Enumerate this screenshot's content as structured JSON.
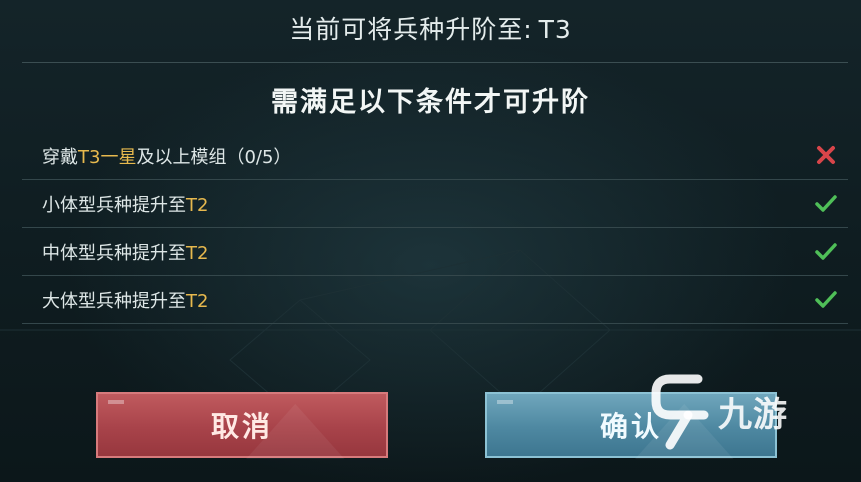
{
  "header": {
    "title": "当前可将兵种升阶至:",
    "tier": "T3"
  },
  "subtitle": "需满足以下条件才可升阶",
  "conditions": [
    {
      "prefix": "穿戴",
      "highlight": "T3一星",
      "suffix": "及以上模组（0/5）",
      "status": "failed",
      "status_icon": "cross-icon",
      "status_color": "#d8454a"
    },
    {
      "prefix": "小体型兵种提升至",
      "highlight": "T2",
      "suffix": "",
      "status": "met",
      "status_icon": "check-icon",
      "status_color": "#4fbf58"
    },
    {
      "prefix": "中体型兵种提升至",
      "highlight": "T2",
      "suffix": "",
      "status": "met",
      "status_icon": "check-icon",
      "status_color": "#4fbf58"
    },
    {
      "prefix": "大体型兵种提升至",
      "highlight": "T2",
      "suffix": "",
      "status": "met",
      "status_icon": "check-icon",
      "status_color": "#4fbf58"
    }
  ],
  "buttons": {
    "cancel_label": "取消",
    "confirm_label": "确认"
  },
  "watermark": {
    "text": "九游",
    "icon": "nine-game-logo-icon"
  },
  "colors": {
    "highlight": "#e7b94e",
    "cancel": "#a8434a",
    "confirm": "#4e88a1"
  }
}
